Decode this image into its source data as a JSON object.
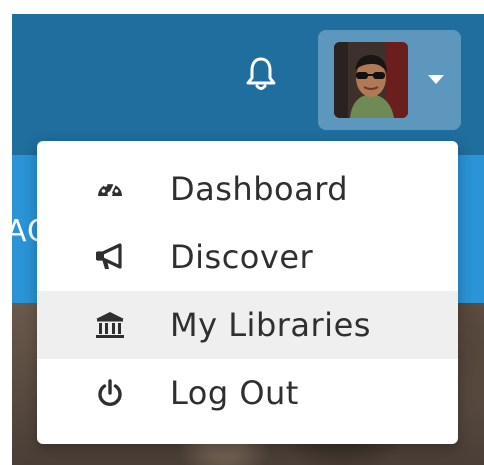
{
  "header": {
    "notifications_icon": "bell-icon",
    "subbar_partial_text": "AC"
  },
  "user_menu": {
    "caret_icon": "caret-down-icon",
    "items": [
      {
        "label": "Dashboard",
        "icon": "dashboard-gauge-icon"
      },
      {
        "label": "Discover",
        "icon": "megaphone-icon"
      },
      {
        "label": "My Libraries",
        "icon": "library-building-icon",
        "highlighted": true
      },
      {
        "label": "Log Out",
        "icon": "power-icon"
      }
    ]
  },
  "colors": {
    "navbar": "#1f6e9e",
    "subbar": "#2a94d6",
    "toggle_bg": "#5e97bd",
    "hover_bg": "#efefef",
    "text": "#2f2f2f"
  }
}
